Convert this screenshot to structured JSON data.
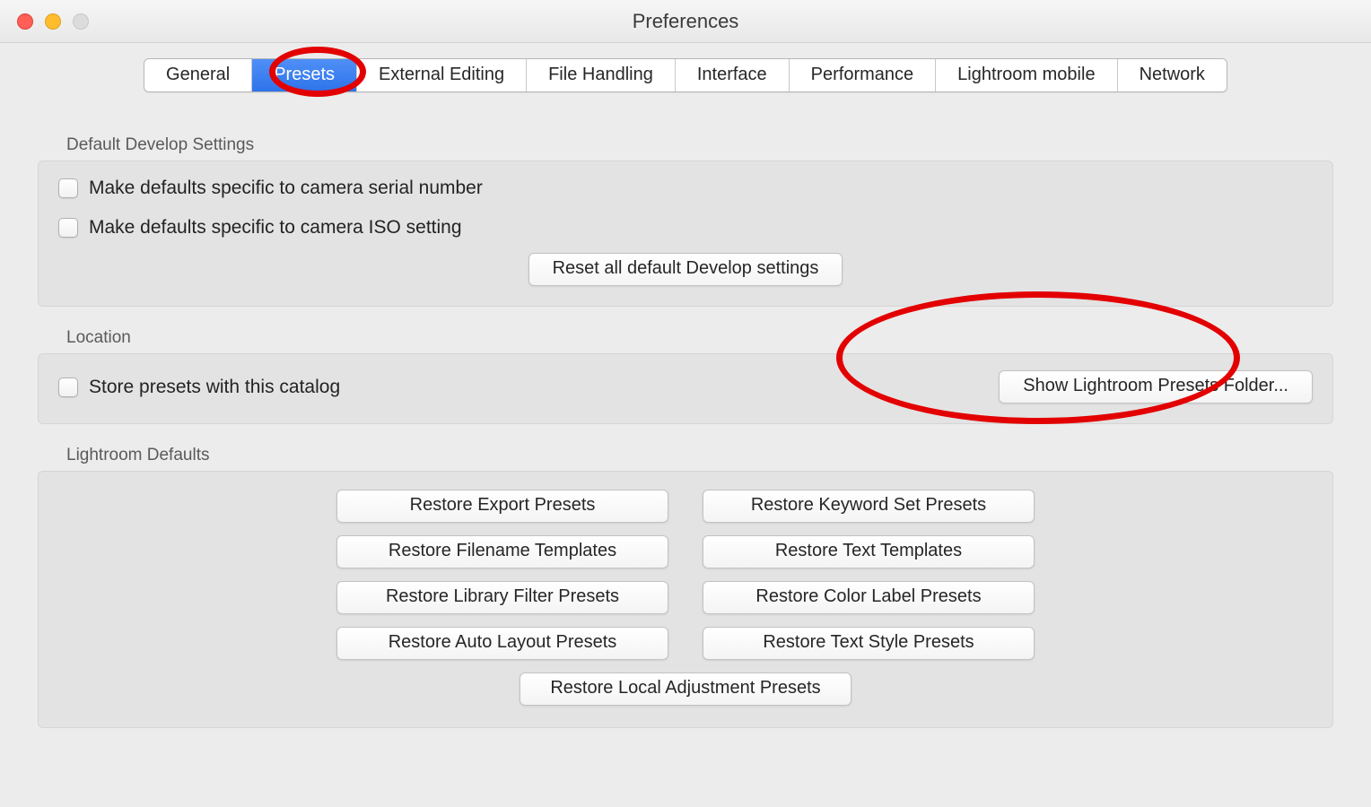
{
  "window": {
    "title": "Preferences"
  },
  "tabs": [
    {
      "label": "General",
      "active": false
    },
    {
      "label": "Presets",
      "active": true
    },
    {
      "label": "External Editing",
      "active": false
    },
    {
      "label": "File Handling",
      "active": false
    },
    {
      "label": "Interface",
      "active": false
    },
    {
      "label": "Performance",
      "active": false
    },
    {
      "label": "Lightroom mobile",
      "active": false
    },
    {
      "label": "Network",
      "active": false
    }
  ],
  "sections": {
    "develop": {
      "title": "Default Develop Settings",
      "checks": [
        {
          "label": "Make defaults specific to camera serial number",
          "checked": false
        },
        {
          "label": "Make defaults specific to camera ISO setting",
          "checked": false
        }
      ],
      "reset_btn": "Reset all default Develop settings"
    },
    "location": {
      "title": "Location",
      "check": {
        "label": "Store presets with this catalog",
        "checked": false
      },
      "show_btn": "Show Lightroom Presets Folder..."
    },
    "defaults": {
      "title": "Lightroom Defaults",
      "buttons": [
        "Restore Export Presets",
        "Restore Keyword Set Presets",
        "Restore Filename Templates",
        "Restore Text Templates",
        "Restore Library Filter Presets",
        "Restore Color Label Presets",
        "Restore Auto Layout Presets",
        "Restore Text Style Presets"
      ],
      "last_button": "Restore Local Adjustment Presets"
    }
  }
}
